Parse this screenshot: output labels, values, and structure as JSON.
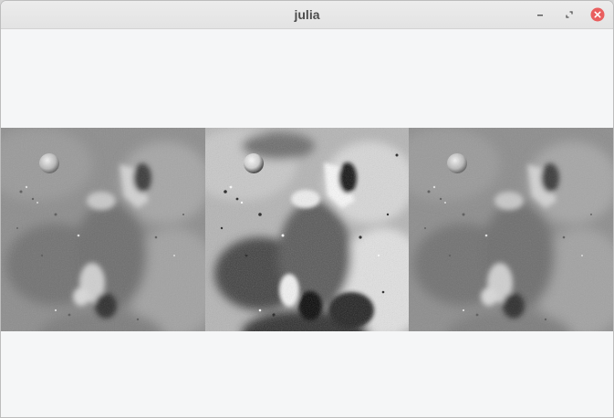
{
  "window": {
    "title": "julia"
  },
  "titlebar": {
    "buttons": [
      {
        "name": "minimize",
        "icon": "minimize-icon"
      },
      {
        "name": "maximize",
        "icon": "maximize-icon"
      },
      {
        "name": "close",
        "icon": "close-icon",
        "color": "#e95e5e"
      }
    ]
  },
  "images": [
    {
      "name": "lunar-surface-original",
      "contrast": "normal"
    },
    {
      "name": "lunar-surface-enhanced",
      "contrast": "high"
    },
    {
      "name": "lunar-surface-copy",
      "contrast": "normal"
    }
  ],
  "colors": {
    "background": "#f5f6f7",
    "titlebar": "#e5e5e5",
    "close_button": "#e95e5e"
  }
}
